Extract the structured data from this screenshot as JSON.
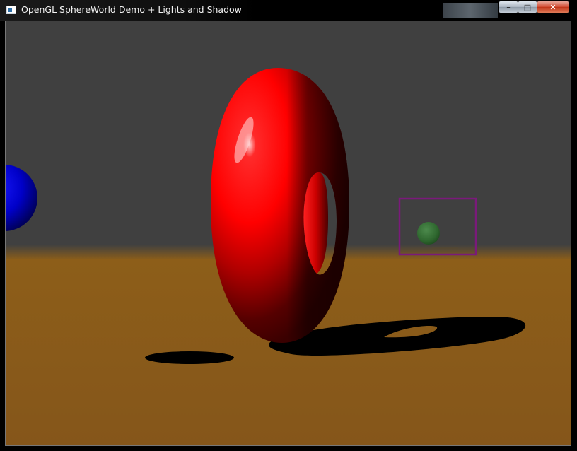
{
  "window": {
    "title": "OpenGL SphereWorld Demo + Lights and Shadow",
    "buttons": {
      "minimize": "–",
      "maximize": "□",
      "close": "✕"
    }
  },
  "scene": {
    "sky_color": "#404040",
    "floor_color": "#8a5b17",
    "torus_color": "#ff0000",
    "left_sphere_color": "#0000b4",
    "small_sphere_color": "#2f6a2f",
    "selection_box_color": "#7a1a7a"
  }
}
